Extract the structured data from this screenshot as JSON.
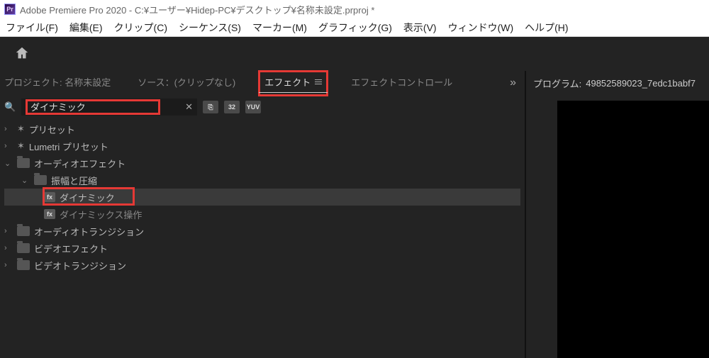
{
  "titlebar": {
    "app": "Adobe Premiere Pro 2020",
    "path": "C:¥ユーザー¥Hidep-PC¥デスクトップ¥名称未設定.prproj *"
  },
  "menubar": {
    "file": "ファイル(F)",
    "edit": "編集(E)",
    "clip": "クリップ(C)",
    "sequence": "シーケンス(S)",
    "marker": "マーカー(M)",
    "graphic": "グラフィック(G)",
    "view": "表示(V)",
    "window": "ウィンドウ(W)",
    "help": "ヘルプ(H)"
  },
  "left_tabs": {
    "project": "プロジェクト: 名称未設定",
    "source": "ソース：(クリップなし)",
    "effects": "エフェクト",
    "effect_controls": "エフェクトコントロール"
  },
  "search": {
    "value": "ダイナミック"
  },
  "tool_chips": {
    "a": "⎘",
    "b": "32",
    "c": "YUV"
  },
  "tree": {
    "presets": "プリセット",
    "lumetri": "Lumetri プリセット",
    "audio_effects": "オーディオエフェクト",
    "amp_comp": "振幅と圧縮",
    "dynamic": "ダイナミック",
    "dynamics_op": "ダイナミックス操作",
    "audio_trans": "オーディオトランジション",
    "video_effects": "ビデオエフェクト",
    "video_trans": "ビデオトランジション"
  },
  "program_panel": {
    "label_prefix": "プログラム:",
    "seq_name": "49852589023_7edc1babf7"
  }
}
